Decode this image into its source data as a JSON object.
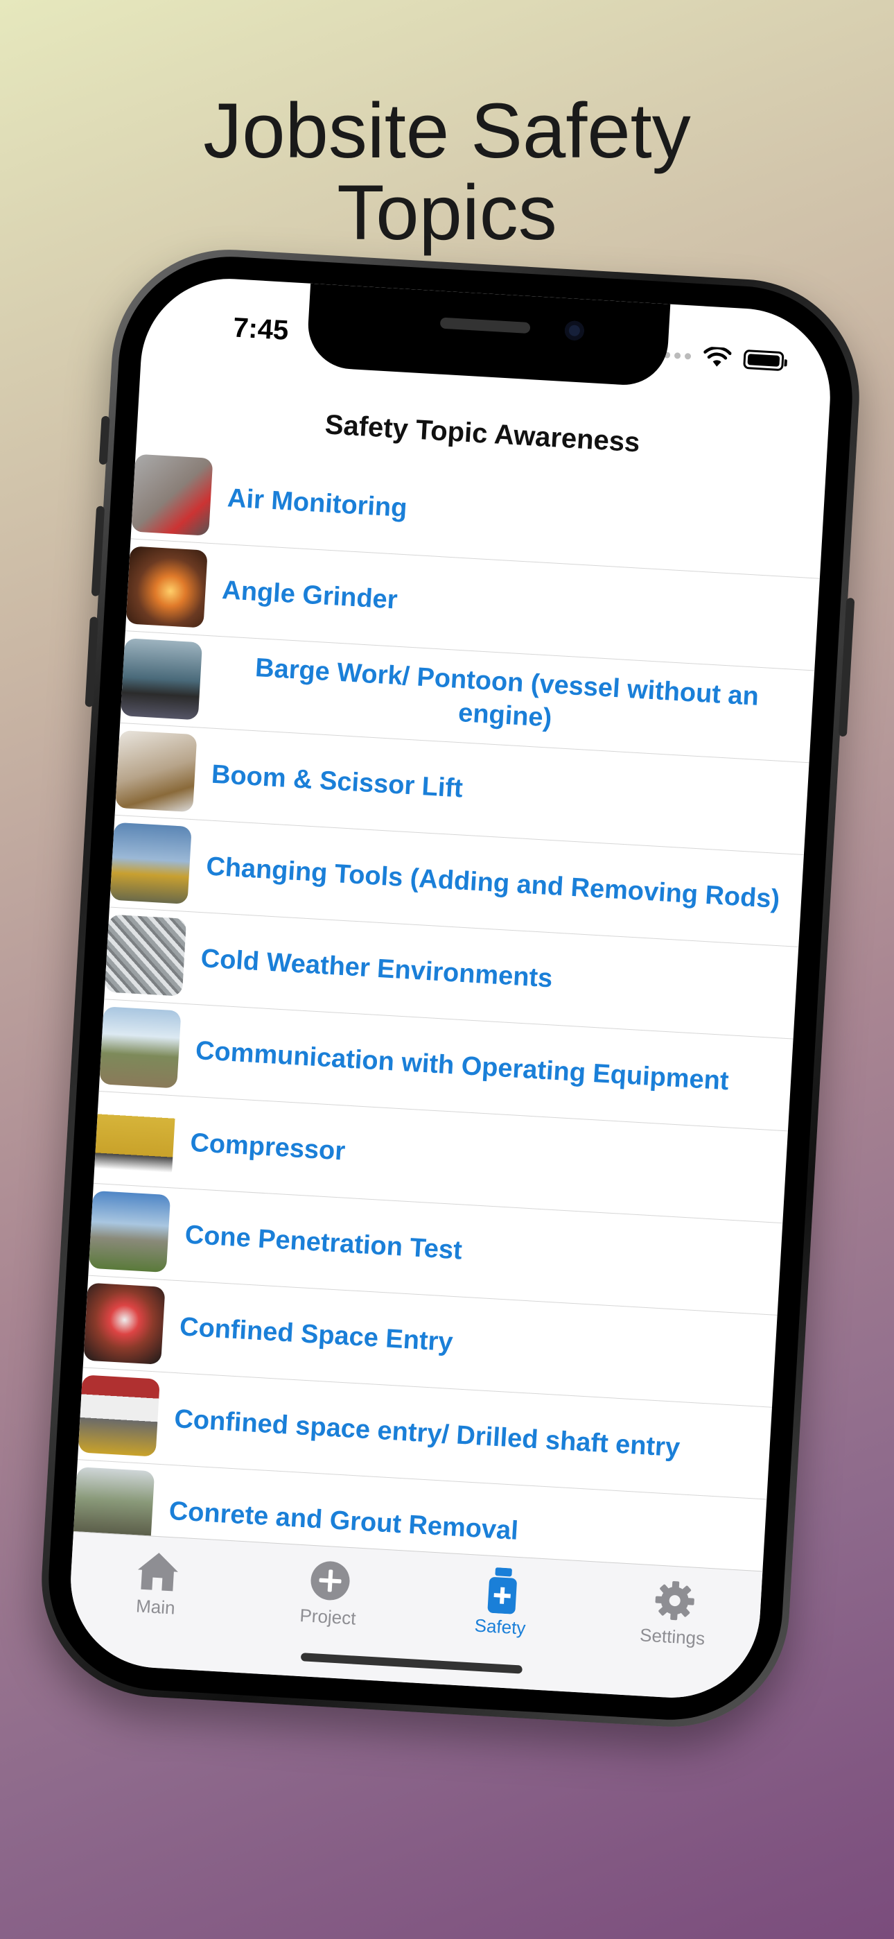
{
  "headline": {
    "line1": "Jobsite Safety",
    "line2": "Topics"
  },
  "status_bar": {
    "time": "7:45"
  },
  "nav": {
    "title": "Safety Topic Awareness"
  },
  "topics": [
    {
      "label": "Air Monitoring",
      "thumb_color": "#8a7f78"
    },
    {
      "label": "Angle Grinder",
      "thumb_color": "#6b3a22"
    },
    {
      "label": "Barge Work/ Pontoon (vessel without an engine)",
      "thumb_color": "#4a6a7a"
    },
    {
      "label": "Boom & Scissor Lift",
      "thumb_color": "#b7a48a"
    },
    {
      "label": "Changing Tools (Adding and Removing Rods)",
      "thumb_color": "#5b86b5"
    },
    {
      "label": "Cold Weather Environments",
      "thumb_color": "#9aa0a3"
    },
    {
      "label": "Communication with Operating Equipment",
      "thumb_color": "#7d8a5a"
    },
    {
      "label": "Compressor",
      "thumb_color": "#d6b43a"
    },
    {
      "label": "Cone Penetration Test",
      "thumb_color": "#5a8a9a"
    },
    {
      "label": "Confined Space Entry",
      "thumb_color": "#8a3a2a"
    },
    {
      "label": "Confined space entry/ Drilled shaft entry",
      "thumb_color": "#b03030"
    },
    {
      "label": "Conrete and Grout Removal",
      "thumb_color": "#6a7058"
    }
  ],
  "tabbar": {
    "tabs": [
      {
        "label": "Main",
        "icon": "house-icon",
        "active": false
      },
      {
        "label": "Project",
        "icon": "plus-circle-icon",
        "active": false
      },
      {
        "label": "Safety",
        "icon": "medicine-bottle-icon",
        "active": true
      },
      {
        "label": "Settings",
        "icon": "gear-icon",
        "active": false
      }
    ]
  },
  "colors": {
    "accent": "#1a7fd8",
    "inactive": "#8e8e93"
  }
}
